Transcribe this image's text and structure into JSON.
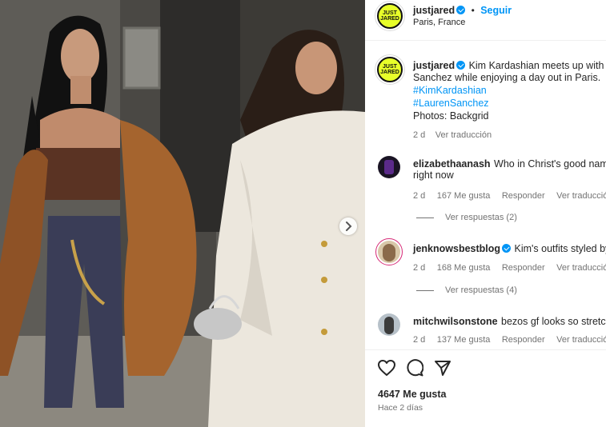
{
  "header": {
    "username": "justjared",
    "avatar_text": "JUST\nJARED",
    "follow_label": "Seguir",
    "location": "Paris, France"
  },
  "caption": {
    "username": "justjared",
    "text_line1": "Kim Kardashian meets up with",
    "text_line2": "Sanchez while enjoying a day out in Paris.",
    "hashtag1": "#KimKardashian",
    "hashtag2": "#LaurenSanchez",
    "credit": "Photos: Backgrid",
    "time": "2 d",
    "translate": "Ver traducción"
  },
  "comments": [
    {
      "username": "elizabethaanash",
      "text_line1": "Who in Christ's good nam",
      "text_line2": "right now",
      "time": "2 d",
      "likes": "167 Me gusta",
      "reply": "Responder",
      "translate": "Ver traducción",
      "view_replies": "Ver respuestas (2)"
    },
    {
      "username": "jenknowsbestblog",
      "text_line1": "Kim's outfits styled by",
      "time": "2 d",
      "likes": "168 Me gusta",
      "reply": "Responder",
      "translate": "Ver traducción",
      "view_replies": "Ver respuestas (4)"
    },
    {
      "username": "mitchwilsonstone",
      "text_line1": "bezos gf looks so stretch",
      "time": "2 d",
      "likes": "137 Me gusta",
      "reply": "Responder",
      "translate": "Ver traducción"
    }
  ],
  "actions": {
    "like_icon": "heart-icon",
    "comment_icon": "comment-icon",
    "share_icon": "share-icon"
  },
  "likes_count": "4647 Me gusta",
  "post_time": "Hace 2 días",
  "colors": {
    "accent": "#0095f6",
    "avatar_bg": "#e8ff2a",
    "muted": "#737373"
  }
}
